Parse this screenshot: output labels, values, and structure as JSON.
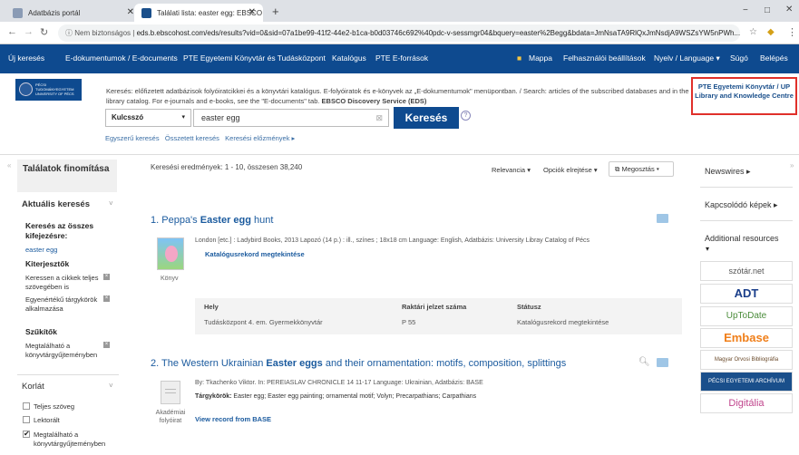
{
  "browser": {
    "tabs": [
      {
        "title": "Adatbázis portál"
      },
      {
        "title": "Találati lista: easter egg: EBSCO D"
      }
    ],
    "new_tab": "+",
    "url_prefix": "Nem biztonságos",
    "url": "eds.b.ebscohost.com/eds/results?vid=0&sid=07a1be99-41f2-44e2-b1ca-b0d03746c692%40pdc-v-sessmgr04&bquery=easter%2Begg&bdata=JmNsaTA9RlQxJmNsdjA9WSZsYW5nPWh...",
    "window_controls": [
      "−",
      "□",
      "✕"
    ]
  },
  "nav": {
    "left": [
      "Új keresés",
      "E-dokumentumok / E-documents",
      "PTE Egyetemi Könyvtár és Tudásközpont",
      "Katalógus",
      "PTE E-források"
    ],
    "right": [
      "Mappa",
      "Felhasználói beállítások",
      "Nyelv / Language ▾",
      "Súgó",
      "Belépés"
    ]
  },
  "header": {
    "logo_text": "PÉCSI TUDOMÁNYEGYETEM UNIVERSITY OF PÉCS",
    "notice": "Keresés: előfizetett adatbázisok folyóiratcikkei és a könyvtári katalógus. E-folyóiratok és e-könyvek az „E-dokumentumok\" menüpontban. / Search: articles of the subscribed databases and in the library catalog. For e-journals and e-books, see the \"E-documents\" tab.",
    "notice_bold": "EBSCO Discovery Service (EDS)",
    "pte_box": "PTE Egyetemi Könyvtár / UP Library and Knowledge Centre",
    "select_value": "Kulcsszó",
    "search_value": "easter egg",
    "search_button": "Keresés",
    "links": [
      "Egyszerű keresés",
      "Összetett keresés",
      "Keresési előzmények ▸"
    ]
  },
  "left": {
    "facet_title": "Találatok finomítása",
    "current_search": "Aktuális keresés",
    "all_search_label": "Keresés az összes kifejezésre:",
    "all_search_value": "easter egg",
    "expanders": "Kiterjesztők",
    "exp_items": [
      "Keressen a cikkek teljes szövegében is",
      "Egyenértékű tárgykörök alkalmazása"
    ],
    "narrowers": "Szűkítők",
    "narrow_items": [
      "Megtalálható a könyvtárgyűjteményben"
    ],
    "limit": "Korlát",
    "limit_items": [
      "Teljes szöveg",
      "Lektorált",
      "Megtalálható a könyvtárgyűjteményben"
    ]
  },
  "results": {
    "count": "Keresési eredmények: 1 - 10, összesen 38,240",
    "sort": "Relevancia ▾",
    "options": "Opciók elrejtése ▾",
    "share": "Megosztás ▾",
    "items": [
      {
        "number": "1.",
        "title_pre": "Peppa's",
        "title_bold": "Easter egg",
        "title_post": "hunt",
        "meta": "London [etc.] : Ladybird Books, 2013 Lapozó (14 p.) : ill., színes ; 18x18 cm Language: English, Adatbázis: University Libray Catalog of Pécs",
        "action": "Katalógusrekord megtekintése",
        "type": "Könyv"
      },
      {
        "number": "2.",
        "title_pre": "The Western Ukrainian",
        "title_bold": "Easter eggs",
        "title_post": "and their ornamentation: motifs, composition, splittings",
        "meta": "By: Tkachenko Viktor. In: PEREIASLAV CHRONICLE 14 11-17 Language: Ukrainian, Adatbázis: BASE",
        "subjects_label": "Tárgykörök:",
        "subjects": "Easter egg; Easter egg painting; ornamental motif; Volyn; Precarpathians; Carpathians",
        "action": "View record from BASE",
        "type": "Akadémiai folyóirat"
      }
    ],
    "holdings": {
      "headers": [
        "Hely",
        "Raktári jelzet száma",
        "Státusz"
      ],
      "row": [
        "Tudásközpont 4. em. Gyermekkönyvtár",
        "P 55",
        "Katalógusrekord megtekintése"
      ]
    }
  },
  "right": {
    "newswires": "Newswires ▸",
    "related_images": "Kapcsolódó képek ▸",
    "additional": "Additional resources",
    "resources": [
      "szótár.net",
      "ADT",
      "UpToDate",
      "Embase",
      "Magyar Orvosi Bibliográfia",
      "PÉCSI EGYETEMI ARCHÍVUM",
      "Digitália"
    ]
  },
  "colors": {
    "nav_bg": "#0e4a8f",
    "link": "#1a5a9e",
    "highlight_border": "#e0302a",
    "search_button": "#0e4a8f"
  }
}
